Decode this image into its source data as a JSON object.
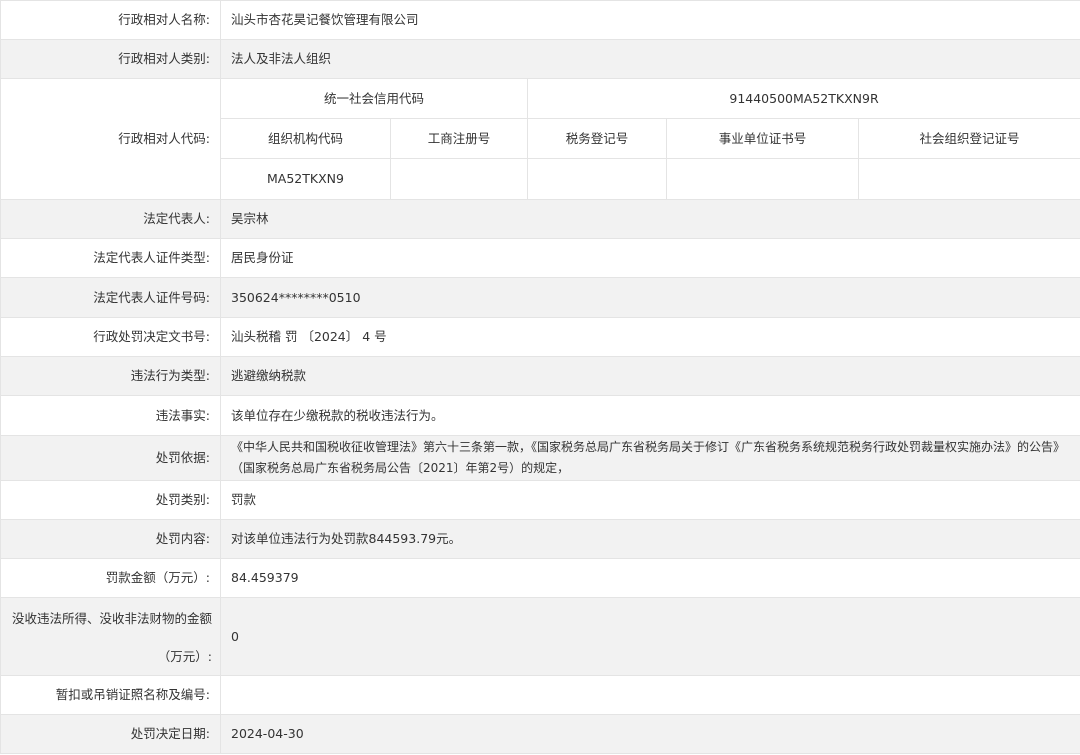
{
  "rows": {
    "name": {
      "label": "行政相对人名称:",
      "value": "汕头市杏花昊记餐饮管理有限公司"
    },
    "category": {
      "label": "行政相对人类别:",
      "value": "法人及非法人组织"
    },
    "code": {
      "label": "行政相对人代码:",
      "uscc_label": "统一社会信用代码",
      "uscc_value": "91440500MA52TKXN9R",
      "headers": [
        "组织机构代码",
        "工商注册号",
        "税务登记号",
        "事业单位证书号",
        "社会组织登记证号"
      ],
      "values": [
        "MA52TKXN9",
        "",
        "",
        "",
        ""
      ]
    },
    "legal_rep": {
      "label": "法定代表人:",
      "value": "吴宗林"
    },
    "id_type": {
      "label": "法定代表人证件类型:",
      "value": "居民身份证"
    },
    "id_number": {
      "label": "法定代表人证件号码:",
      "value": "350624********0510"
    },
    "decision_no": {
      "label": "行政处罚决定文书号:",
      "value": "汕头税稽 罚 〔2024〕 4 号"
    },
    "violation_type": {
      "label": "违法行为类型:",
      "value": "逃避缴纳税款"
    },
    "facts": {
      "label": "违法事实:",
      "value": "该单位存在少缴税款的税收违法行为。"
    },
    "basis": {
      "label": "处罚依据:",
      "value": "《中华人民共和国税收征收管理法》第六十三条第一款，《国家税务总局广东省税务局关于修订《广东省税务系统规范税务行政处罚裁量权实施办法》的公告》（国家税务总局广东省税务局公告〔2021〕年第2号）的规定，"
    },
    "penalty_type": {
      "label": "处罚类别:",
      "value": "罚款"
    },
    "penalty_content": {
      "label": "处罚内容:",
      "value": "对该单位违法行为处罚款844593.79元。"
    },
    "fine_amount": {
      "label": "罚款金额（万元）:",
      "value": "84.459379"
    },
    "confiscation": {
      "label_line1": "没收违法所得、没收非法财物的金额",
      "label_line2": "（万元）:",
      "value": "0"
    },
    "license": {
      "label": "暂扣或吊销证照名称及编号:",
      "value": ""
    },
    "decision_date": {
      "label": "处罚决定日期:",
      "value": "2024-04-30"
    }
  }
}
